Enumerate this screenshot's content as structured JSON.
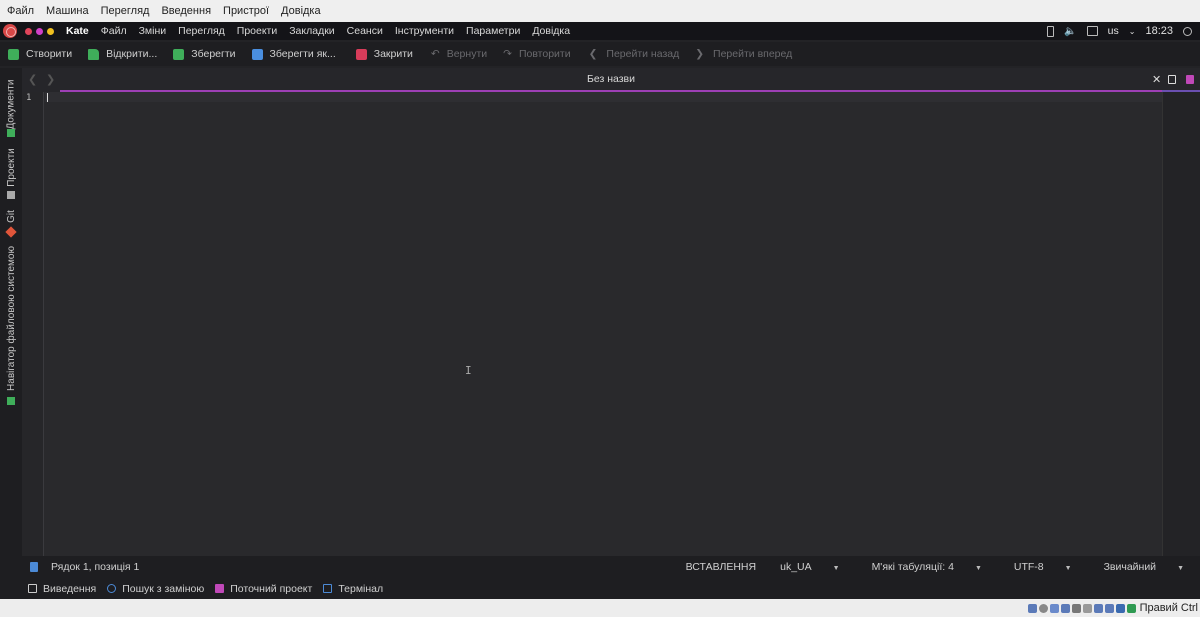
{
  "vm_menu": [
    "Файл",
    "Машина",
    "Перегляд",
    "Введення",
    "Пристрої",
    "Довідка"
  ],
  "topbar": {
    "app_name": "Kate",
    "menu": [
      "Файл",
      "Зміни",
      "Перегляд",
      "Проекти",
      "Закладки",
      "Сеанси",
      "Інструменти",
      "Параметри",
      "Довідка"
    ],
    "keyboard_layout": "us",
    "clock": "18:23",
    "window_dot_colors": [
      "#e0445a",
      "#d040c8",
      "#f0c020"
    ]
  },
  "toolbar": {
    "new": "Створити",
    "open": "Відкрити...",
    "save": "Зберегти",
    "save_as": "Зберегти як...",
    "close": "Закрити",
    "undo": "Вернути",
    "redo": "Повторити",
    "back": "Перейти назад",
    "forward": "Перейти вперед"
  },
  "left_tabs": [
    "Документи",
    "Проекти",
    "Git",
    "Навігатор файловою системою"
  ],
  "tab": {
    "title": "Без назви"
  },
  "editor": {
    "line_number": "1"
  },
  "status": {
    "position": "Рядок 1, позиція 1",
    "mode": "ВСТАВЛЕННЯ",
    "language": "uk_UA",
    "indent": "М'які табуляції: 4",
    "encoding": "UTF-8",
    "highlight": "Звичайний"
  },
  "bottom_tabs": [
    "Виведення",
    "Пошук з заміною",
    "Поточний проект",
    "Термінал"
  ],
  "hostbar": {
    "host_key": "Правий Ctrl"
  },
  "colors": {
    "accent_purple": "#9d3fb5",
    "new_icon": "#3fae5a",
    "save_icon": "#3fae5a",
    "close_icon": "#d83c5a",
    "status_icon": "#4c8ad6"
  }
}
